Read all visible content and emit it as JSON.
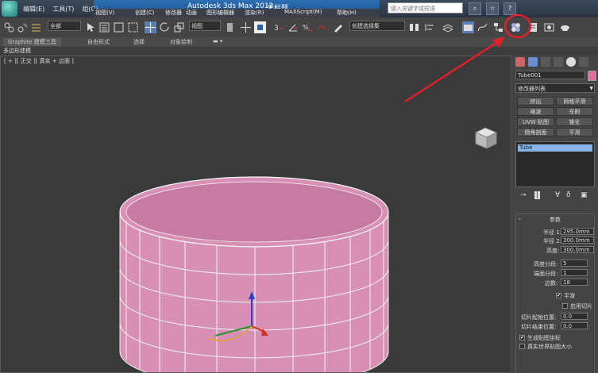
{
  "titlebar": {
    "menu": [
      "编辑(E)",
      "工具(T)",
      "组(G)"
    ],
    "menu2": [
      "视图(V)",
      "创建(C)",
      "修改器",
      "动画",
      "图形编辑器",
      "渲染(R)",
      "MAXScript(M)",
      "帮助(H)"
    ],
    "title": "Autodesk 3ds Max  2012",
    "doc": "无标题",
    "search_placeholder": "键入关键字或短语"
  },
  "toolbar": {
    "selection_filter": "全部",
    "ref_coord": "视图",
    "named_selection": "创建选择集"
  },
  "ribbon": {
    "tabs": [
      "Graphite 建模工具",
      "自由形式",
      "选择",
      "对象绘制"
    ]
  },
  "subbar": {
    "label": "多边形建模"
  },
  "viewport": {
    "label": "[ + ][ 正交 ][ 真实 + 边面 ]"
  },
  "panel": {
    "object_name": "Tube001",
    "modifier_list": "修改器列表",
    "modifier_buttons": [
      "挤出",
      "网格平滑",
      "噪波",
      "车削",
      "UVW 贴图",
      "锥化",
      "倒角剖面",
      "平滑"
    ],
    "stack_item": "Tube",
    "params_header": "参数",
    "radius1_label": "半径 1:",
    "radius1_value": "295.0mm",
    "radius2_label": "半径 2:",
    "radius2_value": "300.0mm",
    "height_label": "高度:",
    "height_value": "300.0mm",
    "height_seg_label": "高度分段:",
    "height_seg_value": "5",
    "cap_seg_label": "端面分段:",
    "cap_seg_value": "1",
    "sides_label": "边数:",
    "sides_value": "18",
    "smooth_label": "平滑",
    "slice_on_label": "启用切片",
    "slice_from_label": "切片起始位置:",
    "slice_from_value": "0.0",
    "slice_to_label": "切片结束位置:",
    "slice_to_value": "0.0",
    "gen_map_label": "生成贴图坐标",
    "real_world_label": "真实世界贴图大小"
  },
  "colors": {
    "tube_fill": "#d88cb0",
    "annotation": "#e0202a"
  }
}
